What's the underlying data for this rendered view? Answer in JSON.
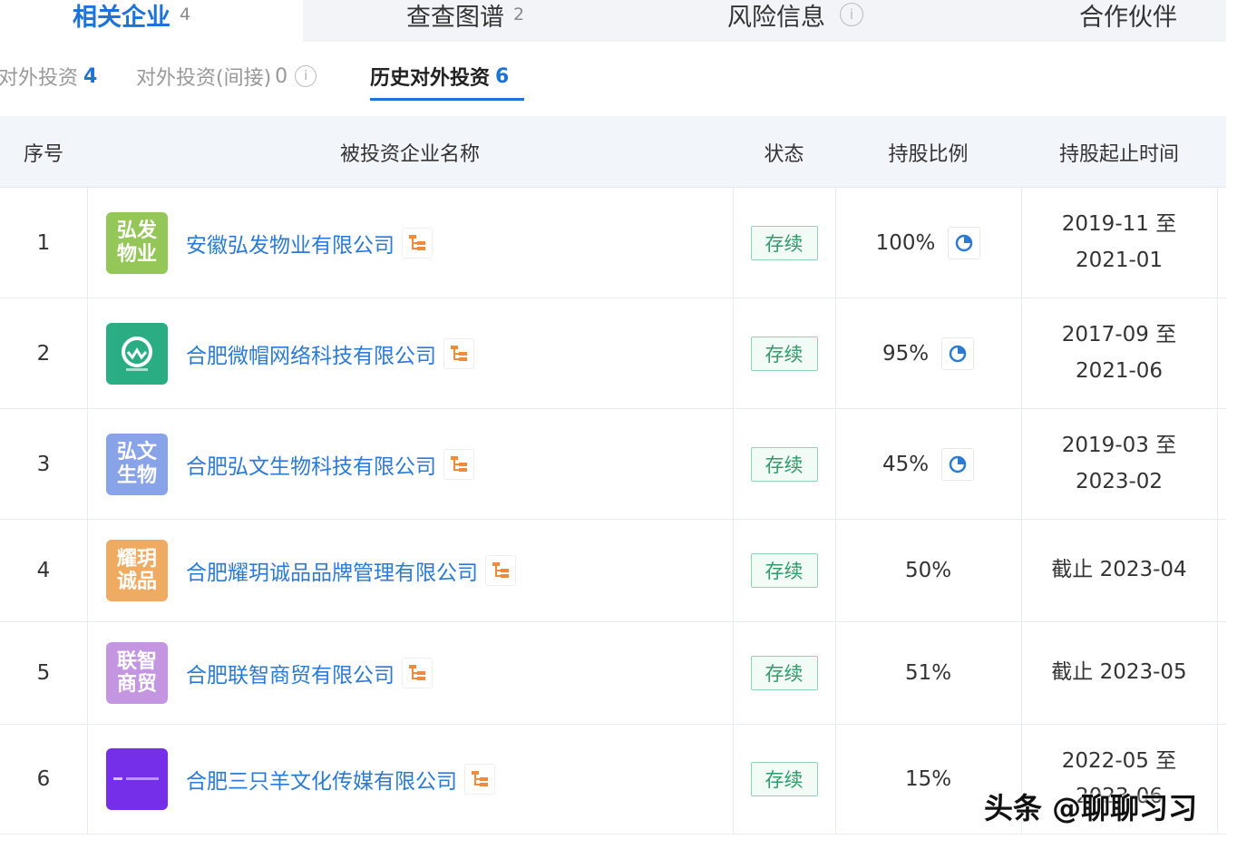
{
  "top_tabs": [
    {
      "label": "相关企业",
      "count": "4"
    },
    {
      "label": "查查图谱",
      "count": "2"
    },
    {
      "label": "风险信息",
      "count": ""
    },
    {
      "label": "合作伙伴",
      "count": ""
    }
  ],
  "sub_tabs": [
    {
      "label": "对外投资",
      "count": "4"
    },
    {
      "label": "对外投资(间接)",
      "count": "0"
    },
    {
      "label": "历史对外投资",
      "count": "6"
    }
  ],
  "table": {
    "headers": [
      "序号",
      "被投资企业名称",
      "状态",
      "持股比例",
      "持股起止时间"
    ],
    "rows": [
      {
        "index": "1",
        "logo_text": "弘发\n物业",
        "logo_color": "#8bc34a",
        "name": "安徽弘发物业有限公司",
        "status": "存续",
        "ratio": "100%",
        "has_chart": true,
        "time_line1": "2019-11 至",
        "time_line2": "2021-01"
      },
      {
        "index": "2",
        "logo_text": "",
        "logo_color": "#1aa779",
        "name": "合肥微帽网络科技有限公司",
        "status": "存续",
        "ratio": "95%",
        "has_chart": true,
        "time_line1": "2017-09 至",
        "time_line2": "2021-06"
      },
      {
        "index": "3",
        "logo_text": "弘文\n生物",
        "logo_color": "#7f9ce8",
        "name": "合肥弘文生物科技有限公司",
        "status": "存续",
        "ratio": "45%",
        "has_chart": true,
        "time_line1": "2019-03 至",
        "time_line2": "2023-02"
      },
      {
        "index": "4",
        "logo_text": "耀玥\n诚品",
        "logo_color": "#eea455",
        "name": "合肥耀玥诚品品牌管理有限公司",
        "status": "存续",
        "ratio": "50%",
        "has_chart": false,
        "time_line1": "截止 2023-04",
        "time_line2": ""
      },
      {
        "index": "5",
        "logo_text": "联智\n商贸",
        "logo_color": "#c08ee0",
        "name": "合肥联智商贸有限公司",
        "status": "存续",
        "ratio": "51%",
        "has_chart": false,
        "time_line1": "截止 2023-05",
        "time_line2": ""
      },
      {
        "index": "6",
        "logo_text": "",
        "logo_color": "#6a1ee8",
        "name": "合肥三只羊文化传媒有限公司",
        "status": "存续",
        "ratio": "15%",
        "has_chart": false,
        "time_line1": "2022-05 至",
        "time_line2": "2023-06"
      }
    ]
  },
  "watermark": "头条 @聊聊习习",
  "colors": {
    "accent": "#1e73d8",
    "status_green": "#2e9d6a",
    "link": "#2b7ad6"
  }
}
